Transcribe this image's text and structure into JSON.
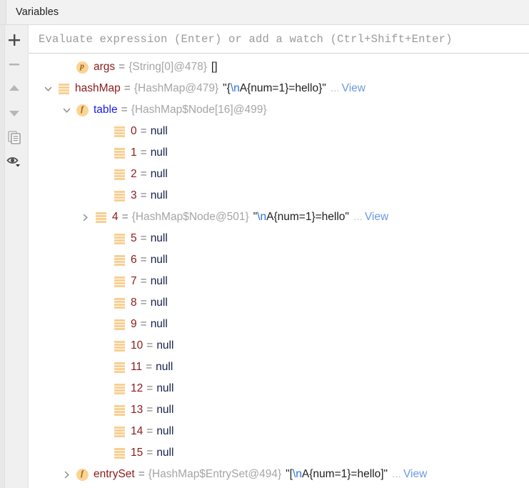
{
  "tab": {
    "label": "Variables"
  },
  "toolbar": {
    "items": [
      {
        "name": "add-watch-button",
        "icon": "plus-icon",
        "title": "Add"
      },
      {
        "name": "remove-watch-button",
        "icon": "minus-icon",
        "title": "Remove"
      },
      {
        "name": "move-up-button",
        "icon": "arrow-up-icon",
        "title": "Up"
      },
      {
        "name": "move-down-button",
        "icon": "arrow-down-icon",
        "title": "Down"
      },
      {
        "name": "copy-value-button",
        "icon": "copy-icon",
        "title": "Copy"
      },
      {
        "name": "view-options-button",
        "icon": "eye-icon",
        "title": "Settings"
      }
    ]
  },
  "evaluate": {
    "placeholder": "Evaluate expression (Enter) or add a watch (Ctrl+Shift+Enter)",
    "value": ""
  },
  "tree": {
    "rows": [
      {
        "indent": 1,
        "chevron": "none",
        "icon": "parameter-icon",
        "icon_letter": "p",
        "name": "args",
        "name_color": "red",
        "type": "{String[0]@478}",
        "value_pre": "[]",
        "value_esc": "",
        "value_post": "",
        "more": "",
        "view": ""
      },
      {
        "indent": 0,
        "chevron": "expanded",
        "icon": "array-icon",
        "icon_letter": "",
        "name": "hashMap",
        "name_color": "red",
        "type": "{HashMap@479}",
        "value_pre": "\"{",
        "value_esc": "\\n",
        "value_post": "A{num=1}=hello}\"",
        "more": "...",
        "view": "View"
      },
      {
        "indent": 1,
        "chevron": "expanded",
        "icon": "field-icon",
        "icon_letter": "f",
        "name": "table",
        "name_color": "blue",
        "type": "{HashMap$Node[16]@499}",
        "value_pre": "",
        "value_esc": "",
        "value_post": "",
        "more": "",
        "view": ""
      },
      {
        "indent": 3,
        "chevron": "none",
        "icon": "array-icon",
        "icon_letter": "",
        "name": "0",
        "name_color": "red",
        "type": "",
        "value_pre": "null",
        "value_esc": "",
        "value_post": "",
        "is_null": true,
        "more": "",
        "view": ""
      },
      {
        "indent": 3,
        "chevron": "none",
        "icon": "array-icon",
        "icon_letter": "",
        "name": "1",
        "name_color": "red",
        "type": "",
        "value_pre": "null",
        "value_esc": "",
        "value_post": "",
        "is_null": true,
        "more": "",
        "view": ""
      },
      {
        "indent": 3,
        "chevron": "none",
        "icon": "array-icon",
        "icon_letter": "",
        "name": "2",
        "name_color": "red",
        "type": "",
        "value_pre": "null",
        "value_esc": "",
        "value_post": "",
        "is_null": true,
        "more": "",
        "view": ""
      },
      {
        "indent": 3,
        "chevron": "none",
        "icon": "array-icon",
        "icon_letter": "",
        "name": "3",
        "name_color": "red",
        "type": "",
        "value_pre": "null",
        "value_esc": "",
        "value_post": "",
        "is_null": true,
        "more": "",
        "view": ""
      },
      {
        "indent": 2,
        "chevron": "collapsed",
        "icon": "array-icon",
        "icon_letter": "",
        "name": "4",
        "name_color": "red",
        "type": "{HashMap$Node@501}",
        "value_pre": "\"",
        "value_esc": "\\n",
        "value_post": "A{num=1}=hello\"",
        "more": "...",
        "view": "View"
      },
      {
        "indent": 3,
        "chevron": "none",
        "icon": "array-icon",
        "icon_letter": "",
        "name": "5",
        "name_color": "red",
        "type": "",
        "value_pre": "null",
        "value_esc": "",
        "value_post": "",
        "is_null": true,
        "more": "",
        "view": ""
      },
      {
        "indent": 3,
        "chevron": "none",
        "icon": "array-icon",
        "icon_letter": "",
        "name": "6",
        "name_color": "red",
        "type": "",
        "value_pre": "null",
        "value_esc": "",
        "value_post": "",
        "is_null": true,
        "more": "",
        "view": ""
      },
      {
        "indent": 3,
        "chevron": "none",
        "icon": "array-icon",
        "icon_letter": "",
        "name": "7",
        "name_color": "red",
        "type": "",
        "value_pre": "null",
        "value_esc": "",
        "value_post": "",
        "is_null": true,
        "more": "",
        "view": ""
      },
      {
        "indent": 3,
        "chevron": "none",
        "icon": "array-icon",
        "icon_letter": "",
        "name": "8",
        "name_color": "red",
        "type": "",
        "value_pre": "null",
        "value_esc": "",
        "value_post": "",
        "is_null": true,
        "more": "",
        "view": ""
      },
      {
        "indent": 3,
        "chevron": "none",
        "icon": "array-icon",
        "icon_letter": "",
        "name": "9",
        "name_color": "red",
        "type": "",
        "value_pre": "null",
        "value_esc": "",
        "value_post": "",
        "is_null": true,
        "more": "",
        "view": ""
      },
      {
        "indent": 3,
        "chevron": "none",
        "icon": "array-icon",
        "icon_letter": "",
        "name": "10",
        "name_color": "red",
        "type": "",
        "value_pre": "null",
        "value_esc": "",
        "value_post": "",
        "is_null": true,
        "more": "",
        "view": ""
      },
      {
        "indent": 3,
        "chevron": "none",
        "icon": "array-icon",
        "icon_letter": "",
        "name": "11",
        "name_color": "red",
        "type": "",
        "value_pre": "null",
        "value_esc": "",
        "value_post": "",
        "is_null": true,
        "more": "",
        "view": ""
      },
      {
        "indent": 3,
        "chevron": "none",
        "icon": "array-icon",
        "icon_letter": "",
        "name": "12",
        "name_color": "red",
        "type": "",
        "value_pre": "null",
        "value_esc": "",
        "value_post": "",
        "is_null": true,
        "more": "",
        "view": ""
      },
      {
        "indent": 3,
        "chevron": "none",
        "icon": "array-icon",
        "icon_letter": "",
        "name": "13",
        "name_color": "red",
        "type": "",
        "value_pre": "null",
        "value_esc": "",
        "value_post": "",
        "is_null": true,
        "more": "",
        "view": ""
      },
      {
        "indent": 3,
        "chevron": "none",
        "icon": "array-icon",
        "icon_letter": "",
        "name": "14",
        "name_color": "red",
        "type": "",
        "value_pre": "null",
        "value_esc": "",
        "value_post": "",
        "is_null": true,
        "more": "",
        "view": ""
      },
      {
        "indent": 3,
        "chevron": "none",
        "icon": "array-icon",
        "icon_letter": "",
        "name": "15",
        "name_color": "red",
        "type": "",
        "value_pre": "null",
        "value_esc": "",
        "value_post": "",
        "is_null": true,
        "more": "",
        "view": ""
      },
      {
        "indent": 1,
        "chevron": "collapsed",
        "icon": "field-icon",
        "icon_letter": "f",
        "name": "entrySet",
        "name_color": "red",
        "type": "{HashMap$EntrySet@494}",
        "value_pre": "\"[",
        "value_esc": "\\n",
        "value_post": "A{num=1}=hello]\"",
        "more": "...",
        "view": "View"
      }
    ]
  },
  "colors": {
    "name_red": "#8a1a1a",
    "name_blue": "#1a1aee",
    "type_gray": "#a5a5a5",
    "link_blue": "#6a9ae0",
    "escape_blue": "#2a6fdb",
    "icon_orange": "#f9cf92",
    "null_navy": "#13204a"
  }
}
